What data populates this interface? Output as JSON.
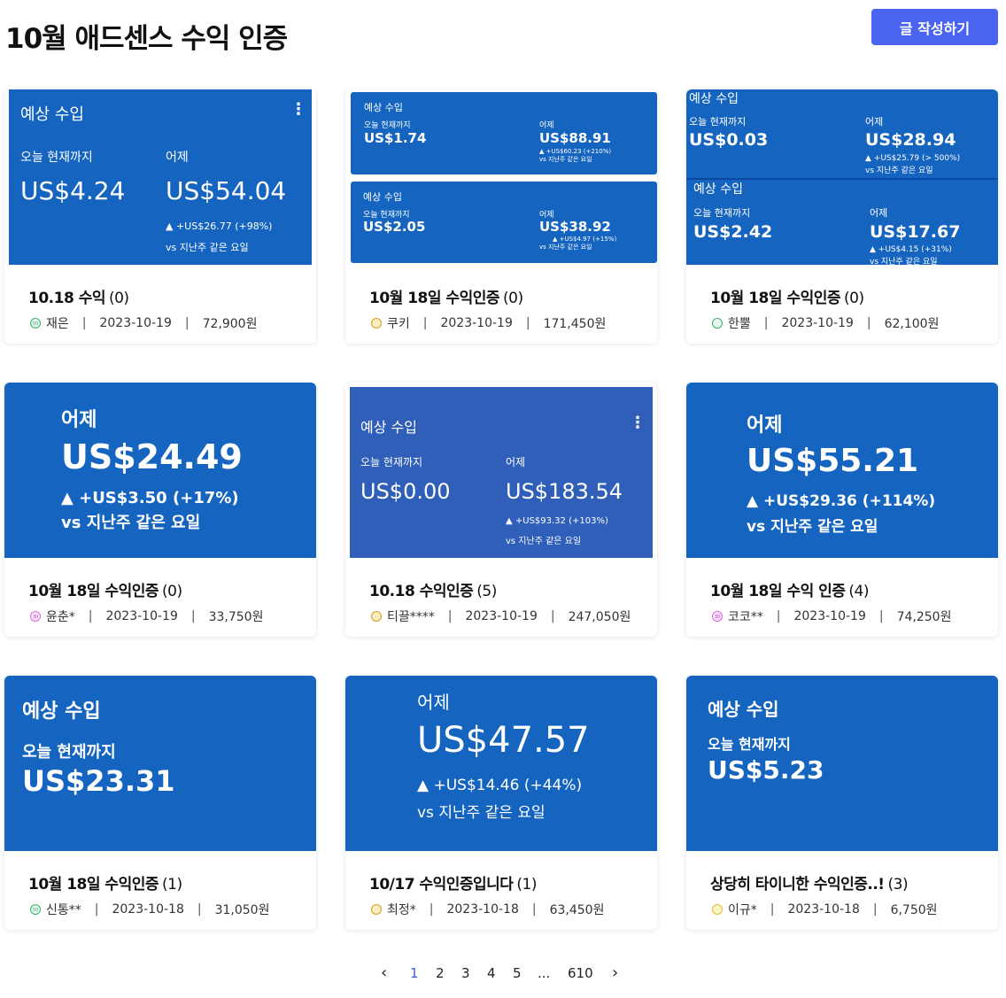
{
  "header": {
    "title": "10월 애드센스 수익 인증",
    "write_label": "글 작성하기"
  },
  "cards": [
    {
      "title": "10.18 수익",
      "comments": "(0)",
      "author": "재은",
      "date": "2023-10-19",
      "amount": "72,900원",
      "level_color": "#3bb273",
      "level_text": "50",
      "thumb": {
        "header": "예상 수입",
        "today_label": "오늘 현재까지",
        "today_value": "US$4.24",
        "yday_label": "어제",
        "yday_value": "US$54.04",
        "change": "▲ +US$26.77 (+98%)",
        "compare": "vs 지난주 같은 요일"
      }
    },
    {
      "title": "10월 18일 수익인증",
      "comments": "(0)",
      "author": "쿠키",
      "date": "2023-10-19",
      "amount": "171,450원",
      "level_color": "#d4a017",
      "level_text": "",
      "thumb": {
        "top": {
          "header": "예상 수입",
          "today_label": "오늘 현재까지",
          "today_value": "US$1.74",
          "yday_label": "어제",
          "yday_value": "US$88.91",
          "change": "▲ +US$60.23 (+210%)",
          "compare": "vs 지난주 같은 요일"
        },
        "bottom": {
          "header": "예상 수입",
          "today_label": "오늘 현재까지",
          "today_value": "US$2.05",
          "yday_label": "어제",
          "yday_value": "US$38.92",
          "change": "▲ +US$4.97 (+15%)",
          "compare": "vs 지난주 같은 요일"
        }
      }
    },
    {
      "title": "10월 18일 수익인증",
      "comments": "(0)",
      "author": "한뿔",
      "date": "2023-10-19",
      "amount": "62,100원",
      "level_color": "#3bb273",
      "level_text": "",
      "thumb": {
        "top": {
          "header": "예상 수입",
          "today_label": "오늘 현재까지",
          "today_value": "US$0.03",
          "yday_label": "어제",
          "yday_value": "US$28.94",
          "change": "▲ +US$25.79 (> 500%)",
          "compare": "vs 지난주 같은 요일"
        },
        "bottom": {
          "header": "예상 수입",
          "today_label": "오늘 현재까지",
          "today_value": "US$2.42",
          "yday_label": "어제",
          "yday_value": "US$17.67",
          "change": "▲ +US$4.15 (+31%)",
          "compare": "vs 지난주 같은 요일"
        }
      }
    },
    {
      "title": "10월 18일 수익인증",
      "comments": "(0)",
      "author": "윤춘*",
      "date": "2023-10-19",
      "amount": "33,750원",
      "level_color": "#d86bd8",
      "level_text": "30",
      "thumb": {
        "yday_label": "어제",
        "yday_value": "US$24.49",
        "change": "▲ +US$3.50 (+17%)",
        "compare": "vs 지난주 같은 요일"
      }
    },
    {
      "title": "10.18 수익인증",
      "comments": "(5)",
      "author": "티끌****",
      "date": "2023-10-19",
      "amount": "247,050원",
      "level_color": "#d4a017",
      "level_text": "",
      "thumb": {
        "header": "예상 수입",
        "today_label": "오늘 현재까지",
        "today_value": "US$0.00",
        "yday_label": "어제",
        "yday_value": "US$183.54",
        "change": "▲ +US$93.32 (+103%)",
        "compare": "vs 지난주 같은 요일"
      }
    },
    {
      "title": "10월 18일 수익 인증",
      "comments": "(4)",
      "author": "코코**",
      "date": "2023-10-19",
      "amount": "74,250원",
      "level_color": "#d86bd8",
      "level_text": "30",
      "thumb": {
        "yday_label": "어제",
        "yday_value": "US$55.21",
        "change": "▲ +US$29.36 (+114%)",
        "compare": "vs 지난주 같은 요일"
      }
    },
    {
      "title": "10월 18일 수익인증",
      "comments": "(1)",
      "author": "신통**",
      "date": "2023-10-18",
      "amount": "31,050원",
      "level_color": "#3bb273",
      "level_text": "50",
      "thumb": {
        "header": "예상 수입",
        "today_label": "오늘 현재까지",
        "today_value": "US$23.31"
      }
    },
    {
      "title": "10/17 수익인증입니다",
      "comments": "(1)",
      "author": "최정*",
      "date": "2023-10-18",
      "amount": "63,450원",
      "level_color": "#d4a017",
      "level_text": "",
      "thumb": {
        "yday_label": "어제",
        "yday_value": "US$47.57",
        "change": "▲ +US$14.46 (+44%)",
        "compare": "vs 지난주 같은 요일"
      }
    },
    {
      "title": "상당히 타이니한 수익인증..!",
      "comments": "(3)",
      "author": "이규*",
      "date": "2023-10-18",
      "amount": "6,750원",
      "level_color": "#e0c030",
      "level_text": "",
      "thumb": {
        "header": "예상 수입",
        "today_label": "오늘 현재까지",
        "today_value": "US$5.23"
      }
    }
  ],
  "pagination": {
    "prev": "‹",
    "pages": [
      "1",
      "2",
      "3",
      "4",
      "5"
    ],
    "ellipsis": "...",
    "last": "610",
    "next": "›",
    "current": "1"
  }
}
